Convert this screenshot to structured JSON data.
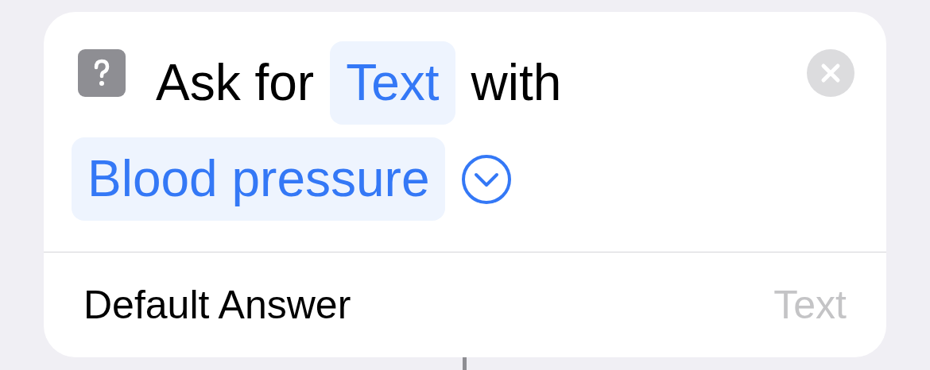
{
  "action": {
    "prefix": "Ask for",
    "type_token": "Text",
    "connector": "with",
    "prompt_token": "Blood pressure",
    "expanded": false
  },
  "default_answer": {
    "label": "Default Answer",
    "placeholder": "Text"
  }
}
